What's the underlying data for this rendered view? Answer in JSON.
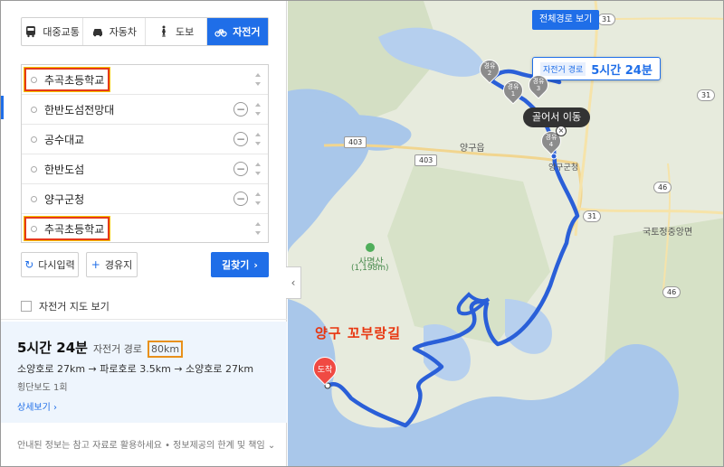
{
  "tabs": [
    {
      "label": "대중교통",
      "icon": "bus-icon"
    },
    {
      "label": "자동차",
      "icon": "car-icon"
    },
    {
      "label": "도보",
      "icon": "walk-icon"
    },
    {
      "label": "자전거",
      "icon": "bicycle-icon",
      "active": true
    }
  ],
  "route": {
    "points": [
      {
        "name": "추곡초등학교",
        "highlighted": true
      },
      {
        "name": "한반도섬전망대"
      },
      {
        "name": "공수대교"
      },
      {
        "name": "한반도섬"
      },
      {
        "name": "양구군청"
      },
      {
        "name": "추곡초등학교",
        "highlighted": true
      }
    ],
    "remove_symbol": "−"
  },
  "buttons": {
    "reset": "다시입력",
    "reset_icon": "↻",
    "add_waypoint": "경유지",
    "add_icon": "+",
    "search": "길찾기",
    "search_arrow": "›"
  },
  "bike_map_label": "자전거 지도 보기",
  "result": {
    "time": "5시간 24분",
    "label": "자전거 경로",
    "distance": "80km",
    "path": "소양호로 27km → 파로호로 3.5km → 소양호로 27km",
    "crossing": "횡단보도 1회",
    "detail": "상세보기 ›"
  },
  "footer": "안내된 정보는 참고 자료로 활용하세요 • 정보제공의 한계 및 책임 ⌄",
  "collapse_symbol": "‹",
  "map": {
    "full_route_button": "전체경로 보기",
    "bubble_mode": "자전거 경로",
    "bubble_time": "5시간 24분",
    "detour_label": "골어서 이동",
    "detour_close": "×",
    "waypoints": [
      {
        "line1": "경유",
        "line2": "2"
      },
      {
        "line1": "경유",
        "line2": "1"
      },
      {
        "line1": "경유",
        "line2": "3"
      },
      {
        "line1": "경유",
        "line2": "4"
      }
    ],
    "arrive_label": "도착",
    "annotation": "양구 꼬부랑길",
    "places": [
      "양구읍",
      "양구군청",
      "국토정중앙면",
      "사명산",
      "(1,198m)"
    ],
    "roads": [
      "403",
      "403",
      "31",
      "31",
      "31",
      "46",
      "46"
    ],
    "colors": {
      "route": "#2a5fd8",
      "water": "#a9c7ea",
      "land": "#e7ebdd",
      "forest": "#cfdcbf",
      "accent": "#1f6ee8",
      "annotation": "#e8350f"
    }
  }
}
